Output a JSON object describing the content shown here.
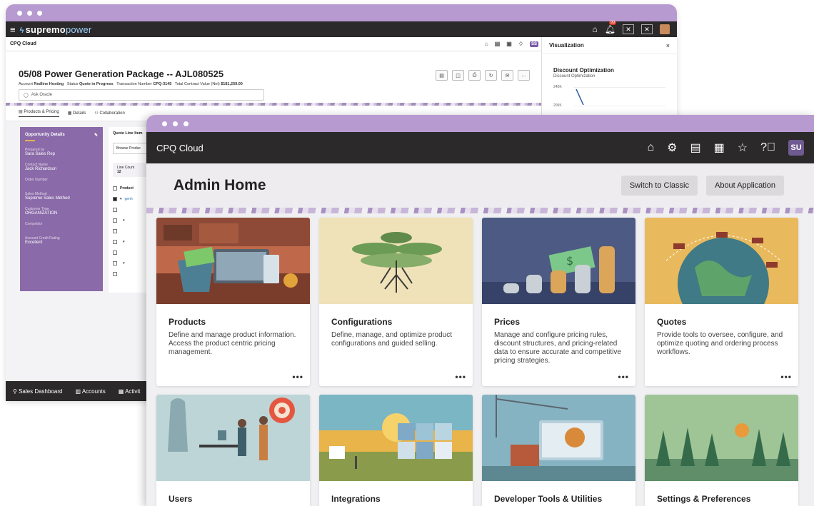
{
  "back": {
    "brand_part1": "supremo",
    "brand_part2": "power",
    "notif_count": "99",
    "app_name": "CPQ Cloud",
    "su": "SS",
    "title": "05/08 Power Generation Package -- AJL080525",
    "meta": {
      "account_label": "Account",
      "account_value": "Redline Hosting",
      "status_label": "Status",
      "status_value": "Quote in Progress",
      "txn_label": "Transaction Number",
      "txn_value": "CPQ-3145",
      "tcv_label": "Total Contract Value (Net)",
      "tcv_value": "$181,259.00"
    },
    "ask_placeholder": "Ask Oracle",
    "tabs": [
      "Products & Pricing",
      "Details",
      "Collaboration"
    ],
    "viz": {
      "header": "Visualization",
      "close": "×",
      "title": "Discount Optimization",
      "subtitle": "Discount Optimization",
      "ticks": [
        "240K",
        "200K"
      ]
    },
    "opp": {
      "title": "Opportunity Details",
      "fields": [
        {
          "label": "Prepared by",
          "value": "Sara Sales Rep"
        },
        {
          "label": "Contact Name",
          "value": "Jack Richardson"
        },
        {
          "label": "Order Number",
          "value": ""
        },
        {
          "label": "Sales Method",
          "value": "Supremo Sales Method"
        },
        {
          "label": "Customer Type",
          "value": "ORGANIZATION"
        },
        {
          "label": "Competitor",
          "value": ""
        },
        {
          "label": "Account Credit Rating",
          "value": "Excellent"
        }
      ]
    },
    "qli": {
      "title": "Quote Line Item",
      "browse": "Browse Produc",
      "line_count_label": "Line Count",
      "line_count": "12",
      "product_header": "Product",
      "first_row": "genh"
    },
    "botnav": [
      "Sales Dashboard",
      "Accounts",
      "Activit"
    ]
  },
  "front": {
    "app_name": "CPQ Cloud",
    "su": "SU",
    "page_title": "Admin Home",
    "switch_classic": "Switch to Classic",
    "about": "About Application",
    "cards": [
      {
        "title": "Products",
        "desc": "Define and manage product information. Access the product centric pricing management.",
        "more": "•••"
      },
      {
        "title": "Configurations",
        "desc": "Define, manage, and optimize product configurations and guided selling.",
        "more": "•••"
      },
      {
        "title": "Prices",
        "desc": "Manage and configure pricing rules, discount structures, and pricing-related data to ensure accurate and competitive pricing strategies.",
        "more": "•••"
      },
      {
        "title": "Quotes",
        "desc": "Provide tools to oversee, configure, and optimize quoting and ordering process workflows.",
        "more": "•••"
      },
      {
        "title": "Users",
        "desc": "",
        "more": ""
      },
      {
        "title": "Integrations",
        "desc": "",
        "more": ""
      },
      {
        "title": "Developer Tools & Utilities",
        "desc": "",
        "more": ""
      },
      {
        "title": "Settings & Preferences",
        "desc": "",
        "more": ""
      }
    ]
  }
}
